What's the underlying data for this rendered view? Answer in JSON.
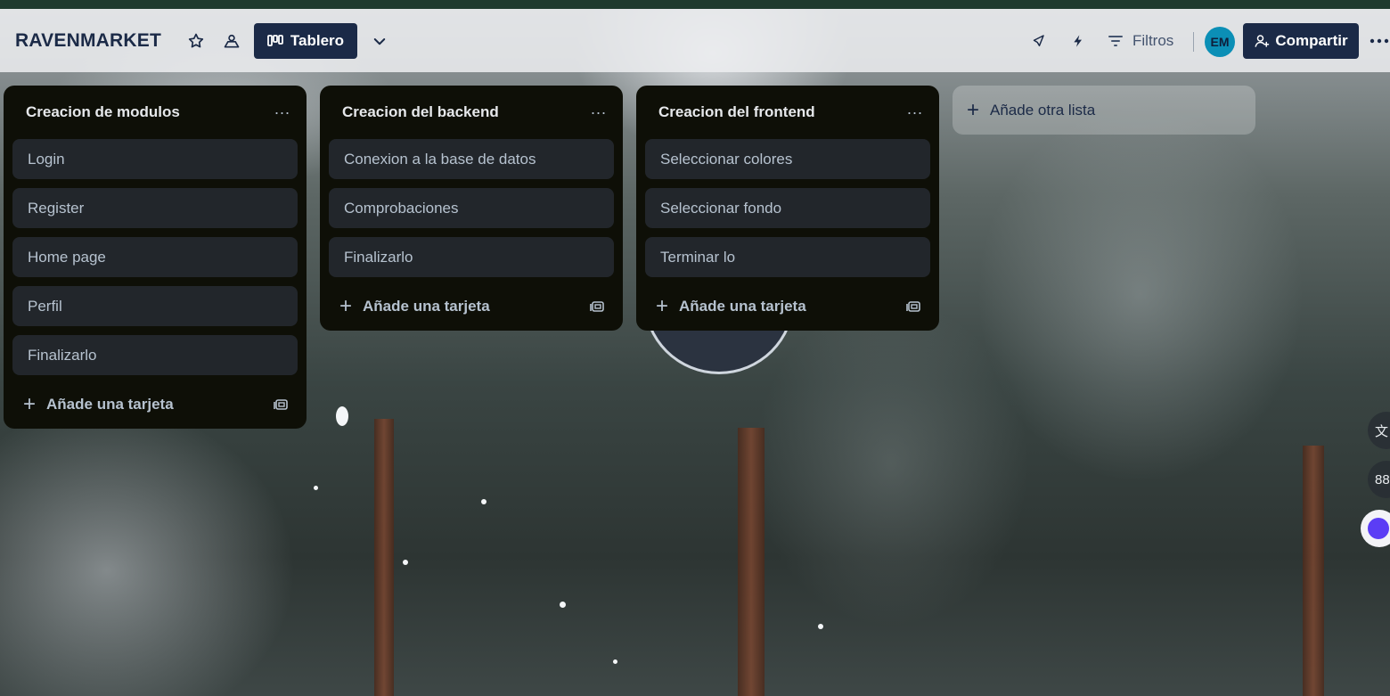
{
  "header": {
    "board_name": "RAVENMARKET",
    "view_label": "Tablero",
    "filters_label": "Filtros",
    "avatar_initials": "EM",
    "share_label": "Compartir"
  },
  "lists": [
    {
      "title": "Creacion de modulos",
      "cards": [
        "Login",
        "Register",
        "Home page",
        "Perfil",
        "Finalizarlo"
      ],
      "add_card_label": "Añade una tarjeta"
    },
    {
      "title": "Creacion del backend",
      "cards": [
        "Conexion a la base de datos",
        "Comprobaciones",
        "Finalizarlo"
      ],
      "add_card_label": "Añade una tarjeta"
    },
    {
      "title": "Creacion del frontend",
      "cards": [
        "Seleccionar colores",
        "Seleccionar fondo",
        "Terminar lo"
      ],
      "add_card_label": "Añade una tarjeta"
    }
  ],
  "add_list_label": "Añade otra lista",
  "icons": {
    "star": "star-icon",
    "visibility": "workspace-visibility-icon",
    "view": "board-view-icon",
    "chevron": "chevron-down-icon",
    "powerups": "rocket-icon",
    "automation": "lightning-icon",
    "filter": "filter-icon",
    "share": "add-person-icon",
    "more": "more-icon",
    "template": "card-template-icon"
  },
  "colors": {
    "header_bg": "#eceef0",
    "primary_button": "#1b2a47",
    "list_bg": "#0e0f07",
    "card_bg": "#22262b",
    "card_text": "#b6c2cf",
    "avatar_bg": "#0b8fb6"
  }
}
